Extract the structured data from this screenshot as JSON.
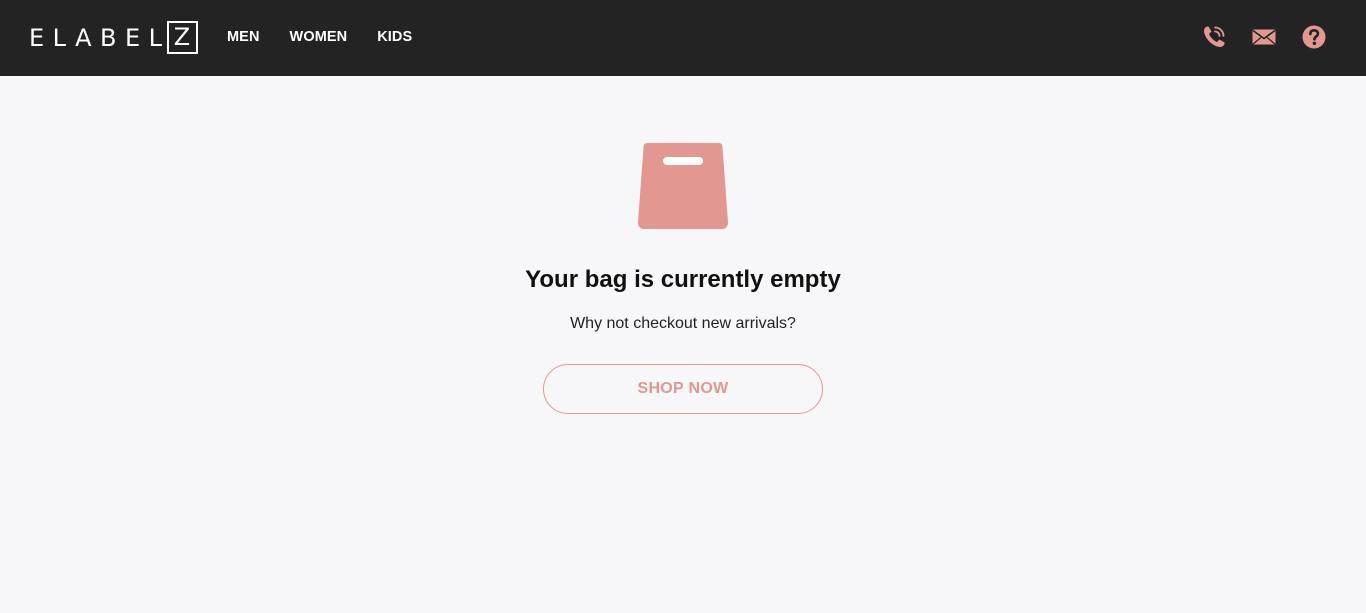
{
  "header": {
    "logo": {
      "text": "ELABEL",
      "boxed_letter": "Z"
    },
    "nav": [
      {
        "label": "MEN"
      },
      {
        "label": "WOMEN"
      },
      {
        "label": "KIDS"
      }
    ],
    "icons": [
      "phone-icon",
      "mail-icon",
      "help-icon"
    ]
  },
  "empty_bag": {
    "icon": "shopping-bag-icon",
    "title": "Your bag is currently empty",
    "subtitle": "Why not checkout new arrivals?",
    "button_label": "SHOP NOW"
  },
  "colors": {
    "header_bg": "#232324",
    "accent": "#e39791",
    "page_bg": "#f7f7f9",
    "title_text": "#111111"
  }
}
